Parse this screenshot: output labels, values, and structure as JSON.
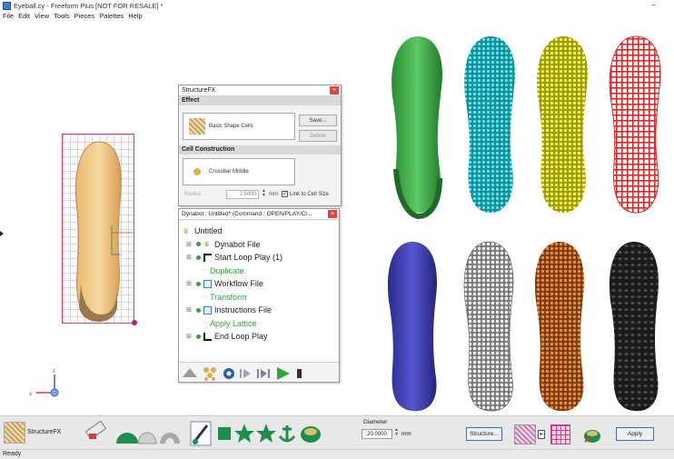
{
  "window": {
    "title": "Eyeball.cy - Freeform Plus [NOT FOR RESALE] *",
    "minimize": "–"
  },
  "menu": [
    "File",
    "Edit",
    "View",
    "Tools",
    "Pieces",
    "Palettes",
    "Help"
  ],
  "structurefx": {
    "title": "StructureFX",
    "close": "×",
    "effect_header": "Effect",
    "effect_name": "Basic Shape Cells",
    "save_label": "Save...",
    "delete_label": "Delete",
    "cell_header": "Cell Construction",
    "cell_name": "Crossbar Middle",
    "radius_label": "Radius",
    "radius_value": "2.5000",
    "radius_unit": "mm",
    "link_label": "Link to Cell Size"
  },
  "dynabot": {
    "title": "Dynabot : Untitled* (Command : OPEN/PLAY/Cl...",
    "close": "×",
    "tree": [
      {
        "label": "Untitled",
        "level": 0
      },
      {
        "label": "Dynabot File",
        "level": 1
      },
      {
        "label": "Start Loop Play (1)",
        "level": 1
      },
      {
        "label": "Duplicate",
        "level": 2
      },
      {
        "label": "Workflow File",
        "level": 1
      },
      {
        "label": "Transform",
        "level": 2
      },
      {
        "label": "Instructions File",
        "level": 1
      },
      {
        "label": "Apply Lattice",
        "level": 2
      },
      {
        "label": "End Loop Play",
        "level": 1
      }
    ]
  },
  "gizmo": {
    "x": "x",
    "z": "z"
  },
  "insoles": [
    {
      "name": "solid-green",
      "color": "#3fae45"
    },
    {
      "name": "cyan-lattice",
      "color": "#26bcc8"
    },
    {
      "name": "yellow-lattice",
      "color": "#dede2a"
    },
    {
      "name": "red-grid",
      "color": "#d52a2a"
    },
    {
      "name": "blue-solid",
      "color": "#3b3cb0"
    },
    {
      "name": "white-lattice",
      "color": "#d8d8d8"
    },
    {
      "name": "orange-lattice",
      "color": "#c86a26"
    },
    {
      "name": "black-solid",
      "color": "#1b1b1b"
    }
  ],
  "bottombar": {
    "structurefx_label": "StructureFX",
    "diameter_label": "Diameter",
    "diameter_value": "20.0000",
    "diameter_unit": "mm",
    "structure_btn": "Structure...",
    "apply_btn": "Apply"
  },
  "status": "Ready"
}
